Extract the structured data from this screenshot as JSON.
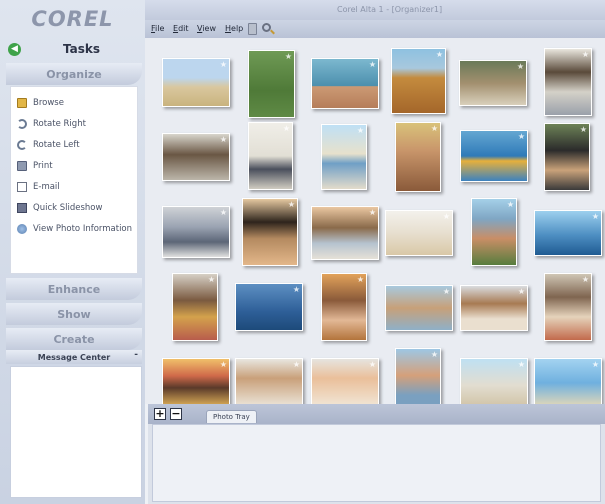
{
  "window_title": "Corel Alta 1 - [Organizer1]",
  "brand": "COREL",
  "menu": [
    "File",
    "Edit",
    "View",
    "Help"
  ],
  "tasks_label": "Tasks",
  "sections": {
    "organize": "Organize",
    "enhance": "Enhance",
    "show": "Show",
    "create": "Create"
  },
  "organize_items": [
    {
      "label": "Browse",
      "icon": "folder-icon"
    },
    {
      "label": "Rotate Right",
      "icon": "rotate-right-icon"
    },
    {
      "label": "Rotate Left",
      "icon": "rotate-left-icon"
    },
    {
      "label": "Print",
      "icon": "print-icon"
    },
    {
      "label": "E-mail",
      "icon": "email-icon"
    },
    {
      "label": "Quick Slideshow",
      "icon": "slideshow-icon"
    },
    {
      "label": "View Photo Information",
      "icon": "info-icon"
    }
  ],
  "message_center": {
    "label": "Message Center",
    "collapse": "-"
  },
  "tray": {
    "add": "+",
    "remove": "−",
    "tab_label": "Photo Tray"
  },
  "photos": [
    "children-running-beach",
    "child-playing-soccer",
    "woman-with-dolphin",
    "golden-retriever-beach",
    "couple-reading",
    "man-on-phone",
    "woman-at-laptop",
    "woman-holding-vase",
    "family-in-pool",
    "smiling-woman-portrait",
    "child-snorkeling",
    "graduates-hugging",
    "man-at-desk",
    "woman-with-afro",
    "colleagues-at-computer",
    "kids-on-sand",
    "family-group-photo",
    "dolphin-jumping",
    "girl-with-flowers",
    "dolphin-underwater",
    "woman-smiling",
    "family-on-beach",
    "father-and-kids",
    "woman-writing",
    "children-group",
    "woman-with-baby",
    "smiling-baby",
    "girl-with-father",
    "family-walking-beach",
    "children-flying-kite"
  ],
  "colors": {
    "accent": "#3fa34a",
    "sidebar": "#d4dbe8",
    "tray": "#b2bbcf"
  }
}
